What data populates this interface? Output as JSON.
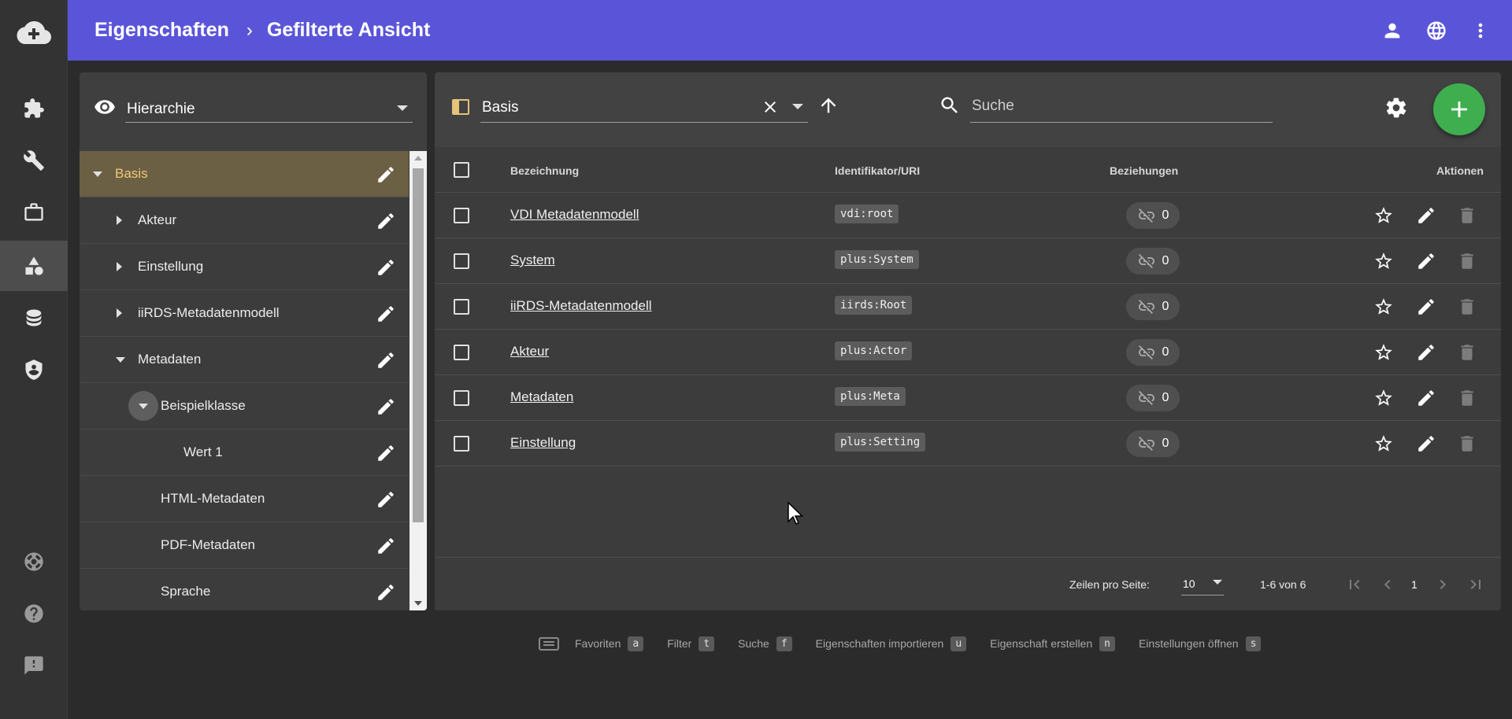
{
  "header": {
    "breadcrumb": [
      "Eigenschaften",
      "Gefilterte Ansicht"
    ],
    "separator": "›"
  },
  "tree": {
    "view_select": "Hierarchie",
    "rows": [
      {
        "label": "Basis",
        "expanded": true,
        "selected": true
      },
      {
        "label": "Akteur",
        "expanded": false
      },
      {
        "label": "Einstellung",
        "expanded": false
      },
      {
        "label": "iiRDS-Metadatenmodell",
        "expanded": false
      },
      {
        "label": "Metadaten",
        "expanded": true
      },
      {
        "label": "Beispielklasse",
        "expanded": true
      },
      {
        "label": "Wert 1"
      },
      {
        "label": "HTML-Metadaten"
      },
      {
        "label": "PDF-Metadaten"
      },
      {
        "label": "Sprache"
      }
    ]
  },
  "toolbar": {
    "filter_value": "Basis",
    "search_placeholder": "Suche"
  },
  "table": {
    "columns": {
      "name": "Bezeichnung",
      "uri": "Identifikator/URI",
      "relations": "Beziehungen",
      "actions": "Aktionen"
    },
    "rows": [
      {
        "name": "VDI Metadatenmodell",
        "uri": "vdi:root",
        "relations": "0"
      },
      {
        "name": "System",
        "uri": "plus:System",
        "relations": "0"
      },
      {
        "name": "iiRDS-Metadatenmodell",
        "uri": "iirds:Root",
        "relations": "0"
      },
      {
        "name": "Akteur",
        "uri": "plus:Actor",
        "relations": "0"
      },
      {
        "name": "Metadaten",
        "uri": "plus:Meta",
        "relations": "0"
      },
      {
        "name": "Einstellung",
        "uri": "plus:Setting",
        "relations": "0"
      }
    ],
    "footer": {
      "rows_per_page_label": "Zeilen pro Seite:",
      "rows_per_page": "10",
      "range": "1-6 von 6",
      "page": "1"
    }
  },
  "shortcuts": [
    {
      "label": "Favoriten",
      "key": "a"
    },
    {
      "label": "Filter",
      "key": "t"
    },
    {
      "label": "Suche",
      "key": "f"
    },
    {
      "label": "Eigenschaften importieren",
      "key": "u"
    },
    {
      "label": "Eigenschaft erstellen",
      "key": "n"
    },
    {
      "label": "Einstellungen öffnen",
      "key": "s"
    }
  ],
  "colors": {
    "header": "#5a55d8",
    "accent_green": "#3fae4f",
    "selected_row": "#6b5f44",
    "selected_text": "#f2c97a"
  },
  "icons": {
    "rail": [
      "cloud-plus-icon",
      "puzzle-icon",
      "wrench-icon",
      "briefcase-icon",
      "shapes-icon",
      "database-icon",
      "shield-user-icon",
      "lifebuoy-icon",
      "help-icon",
      "feedback-icon"
    ],
    "header": [
      "account-icon",
      "globe-icon",
      "more-vert-icon"
    ]
  }
}
